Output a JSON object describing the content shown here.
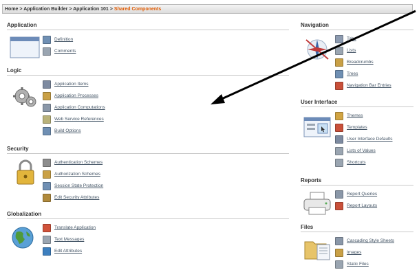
{
  "breadcrumb": {
    "home": "Home",
    "sep": ">",
    "builder": "Application Builder",
    "app": "Application 101",
    "current": "Shared Components"
  },
  "sections": {
    "application": {
      "title": "Application",
      "items": [
        {
          "label": "Definition",
          "icon": "definition-icon",
          "color": "#6f8fb3"
        },
        {
          "label": "Comments",
          "icon": "comments-icon",
          "color": "#9aa5b1"
        }
      ]
    },
    "logic": {
      "title": "Logic",
      "items": [
        {
          "label": "Application Items",
          "icon": "application-items-icon",
          "color": "#7d8aa0"
        },
        {
          "label": "Application Processes",
          "icon": "application-processes-icon",
          "color": "#c9a046"
        },
        {
          "label": "Application Computations",
          "icon": "application-computations-icon",
          "color": "#8a97a8"
        },
        {
          "label": "Web Service References",
          "icon": "web-service-icon",
          "color": "#b9b27a"
        },
        {
          "label": "Build Options",
          "icon": "build-options-icon",
          "color": "#6f8fb3"
        }
      ]
    },
    "security": {
      "title": "Security",
      "items": [
        {
          "label": "Authentication Schemes",
          "icon": "authentication-icon",
          "color": "#8d8d8d"
        },
        {
          "label": "Authorization Schemes",
          "icon": "authorization-icon",
          "color": "#c9a046"
        },
        {
          "label": "Session State Protection",
          "icon": "session-state-icon",
          "color": "#6f8fb3"
        },
        {
          "label": "Edit Security Attributes",
          "icon": "security-attributes-icon",
          "color": "#b08a3c"
        }
      ]
    },
    "globalization": {
      "title": "Globalization",
      "items": [
        {
          "label": "Translate Application",
          "icon": "translate-icon",
          "color": "#d0523a"
        },
        {
          "label": "Text Messages",
          "icon": "text-messages-icon",
          "color": "#9aa5b1"
        },
        {
          "label": "Edit Attributes",
          "icon": "globe-small-icon",
          "color": "#3d7fbf"
        }
      ]
    },
    "navigation": {
      "title": "Navigation",
      "items": [
        {
          "label": "Tabs",
          "icon": "tabs-icon",
          "color": "#8d9bb0"
        },
        {
          "label": "Lists",
          "icon": "lists-icon",
          "color": "#9aa5b1"
        },
        {
          "label": "Breadcrumbs",
          "icon": "breadcrumbs-icon",
          "color": "#c9a046"
        },
        {
          "label": "Trees",
          "icon": "trees-icon",
          "color": "#6f8fb3"
        },
        {
          "label": "Navigation Bar Entries",
          "icon": "navbar-entries-icon",
          "color": "#c9503a"
        }
      ]
    },
    "ui": {
      "title": "User Interface",
      "items": [
        {
          "label": "Themes",
          "icon": "themes-icon",
          "color": "#d1a443"
        },
        {
          "label": "Templates",
          "icon": "templates-icon",
          "color": "#c9503a"
        },
        {
          "label": "User Interface Defaults",
          "icon": "ui-defaults-icon",
          "color": "#7d8aa0"
        },
        {
          "label": "Lists of Values",
          "icon": "lov-icon",
          "color": "#9aa5b1"
        },
        {
          "label": "Shortcuts",
          "icon": "shortcuts-icon",
          "color": "#9aa5b1"
        }
      ]
    },
    "reports": {
      "title": "Reports",
      "items": [
        {
          "label": "Report Queries",
          "icon": "report-queries-icon",
          "color": "#8a97a8"
        },
        {
          "label": "Report Layouts",
          "icon": "report-layouts-icon",
          "color": "#c9503a"
        }
      ]
    },
    "files": {
      "title": "Files",
      "items": [
        {
          "label": "Cascading Style Sheets",
          "icon": "css-icon",
          "color": "#8a97a8"
        },
        {
          "label": "Images",
          "icon": "images-icon",
          "color": "#c9a046"
        },
        {
          "label": "Static Files",
          "icon": "static-files-icon",
          "color": "#9aa5b1"
        }
      ]
    }
  }
}
